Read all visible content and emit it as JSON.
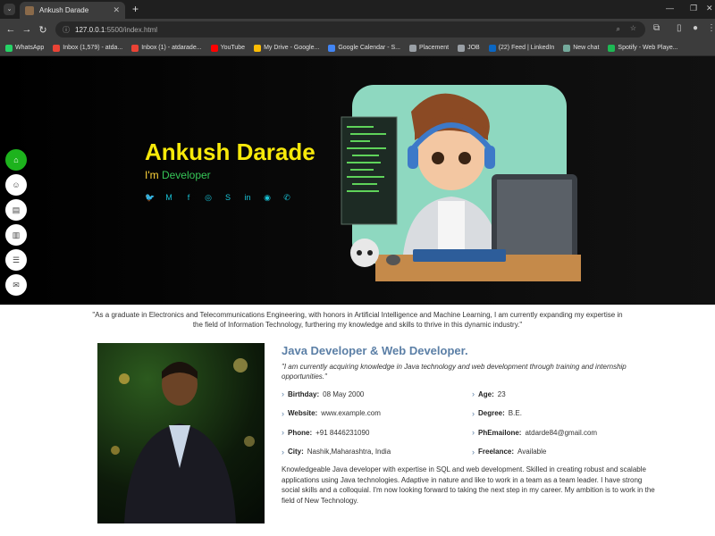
{
  "browser": {
    "tab_title": "Ankush Darade",
    "tab_close": "✕",
    "new_tab": "+",
    "url_host": "127.0.0.1",
    "url_path": ":5500/index.html",
    "bookmarks": [
      {
        "label": "WhatsApp",
        "color": "#25d366"
      },
      {
        "label": "Inbox (1,579) - atda...",
        "color": "#ea4335"
      },
      {
        "label": "Inbox (1) - atdarade...",
        "color": "#ea4335"
      },
      {
        "label": "YouTube",
        "color": "#ff0000"
      },
      {
        "label": "My Drive - Google...",
        "color": "#fbbc04"
      },
      {
        "label": "Google Calendar - S...",
        "color": "#4285f4"
      },
      {
        "label": "Placement",
        "color": "#9aa0a6"
      },
      {
        "label": "JOB",
        "color": "#9aa0a6"
      },
      {
        "label": "(22) Feed | LinkedIn",
        "color": "#0a66c2"
      },
      {
        "label": "New chat",
        "color": "#74aa9c"
      },
      {
        "label": "Spotify - Web Playe...",
        "color": "#1db954"
      }
    ]
  },
  "hero": {
    "name": "Ankush Darade",
    "role_prefix": "I'm",
    "role_value": "Developer",
    "socials": [
      "twitter-icon",
      "gmail-icon",
      "facebook-icon",
      "instagram-icon",
      "skype-icon",
      "linkedin-icon",
      "github-icon",
      "whatsapp-icon"
    ]
  },
  "sidenav": [
    "home-icon",
    "user-icon",
    "file-icon",
    "book-icon",
    "server-icon",
    "envelope-icon"
  ],
  "quote": "\"As a graduate in Electronics and Telecommunications Engineering, with honors in Artificial Intelligence and Machine Learning, I am currently expanding my expertise in the field of Information Technology, furthering my knowledge and skills to thrive in this dynamic industry.\"",
  "about": {
    "title": "Java Developer & Web Developer.",
    "subtitle": "\"I am currently acquiring knowledge in Java technology and web development through training and internship opportunities.\"",
    "fields": [
      {
        "label": "Birthday:",
        "value": "08 May 2000"
      },
      {
        "label": "Age:",
        "value": "23"
      },
      {
        "label": "Website:",
        "value": "www.example.com"
      },
      {
        "label": "Degree:",
        "value": "B.E."
      },
      {
        "label": "Phone:",
        "value": "+91 8446231090"
      },
      {
        "label": "PhEmailone:",
        "value": "atdarde84@gmail.com"
      },
      {
        "label": "City:",
        "value": "Nashik,Maharashtra, India"
      },
      {
        "label": "Freelance:",
        "value": "Available"
      }
    ],
    "body": "Knowledgeable Java developer with expertise in SQL and web development. Skilled in creating robust and scalable applications using Java technologies. Adaptive in nature and like to work in a team as a team leader. I have strong social skills and a colloquial. I'm now looking forward to taking the next step in my career. My ambition is to work in the field of New Technology."
  }
}
